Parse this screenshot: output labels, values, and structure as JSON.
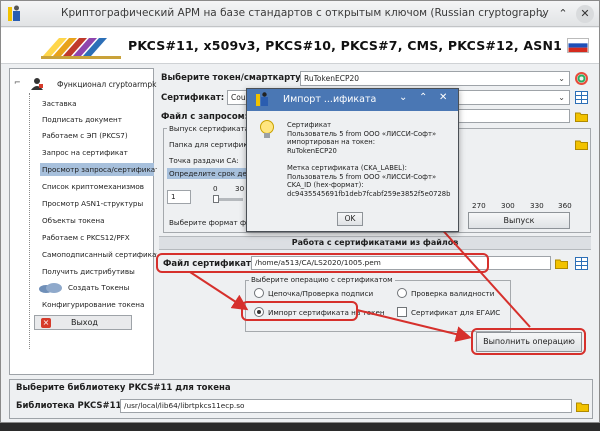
{
  "window": {
    "title": "Криптографический АРМ на базе стандартов с открытым ключом (Russian cryptography"
  },
  "banner": {
    "heading": "PKCS#11, x509v3, PKCS#10, PKCS#7, CMS, PKCS#12, ASN1"
  },
  "sidebar": {
    "root": "Функционал cryptoarmpkcs",
    "items": [
      "Заставка",
      "Подписать документ",
      "Работаем с ЭП (PKCS7)",
      "Запрос на сертификат",
      "Просмотр запроса/сертификата",
      "Список криптомеханизмов",
      "Просмотр ASN1-структуры",
      "Объекты токена",
      "Работаем с PKCS12/PFX",
      "Самоподписанный сертификат",
      "Получить дистрибутивы",
      "Создать Токены",
      "Конфигурирование токена"
    ],
    "exit_label": "Выход"
  },
  "main": {
    "token_label": "Выберите токен/смарткарту:",
    "token_value": "RuTokenECP20",
    "cert_label": "Сертификат:",
    "cert_value": "Cou",
    "request_label": "Файл с запросом:",
    "issue_group_title": "Выпуск сертификата",
    "cert_folder_label": "Папка для сертификат",
    "ca_point_label": "Точка раздачи CA:",
    "validity_label": "Определите срок дейст",
    "slider_value": "1",
    "slider_ticks": [
      "0",
      "30"
    ],
    "slider_ticks_right": [
      "270",
      "300",
      "330",
      "360"
    ],
    "format_label": "Выберите формат фа",
    "issue_button": "Выпуск",
    "section_header": "Работа с сертификатами из файлов",
    "cert_file_label": "Файл сертификата:",
    "cert_file_value": "/home/a513/CA/LS2020/1005.pem",
    "op_group_title": "Выберите операцию с сертификатом",
    "op_chain": "Цепочка/Проверка подписи",
    "op_validity": "Проверка валидности",
    "op_import": "Импорт сертификата на токен",
    "op_egais": "Сертификат для ЕГАИС",
    "run_button": "Выполнить операцию"
  },
  "bottom": {
    "title": "Выберите библиотеку PKCS#11 для токена",
    "lib_label": "Библиотека PKCS#11:",
    "lib_value": "/usr/local/lib64/librtpkcs11ecp.so"
  },
  "dialog": {
    "title": "Импорт ...ификата",
    "message_lines": [
      "Сертификат",
      "Пользователь 5 from ООО «ЛИССИ-Софт»",
      "импортирован на токен:",
      "RuTokenECP20",
      "",
      "Метка сертификата (CKA_LABEL):",
      "Пользователь 5 from ООО «ЛИССИ-Софт»",
      "CKA_ID (hex-формат):",
      "dc9435545691fb1deb7fcabf259e3852f5e0728b"
    ],
    "ok_label": "OK"
  },
  "colors": {
    "dialog_title_bg": "#4a77b4",
    "highlight_red": "#d6302c",
    "selection": "#a7c0dc"
  }
}
